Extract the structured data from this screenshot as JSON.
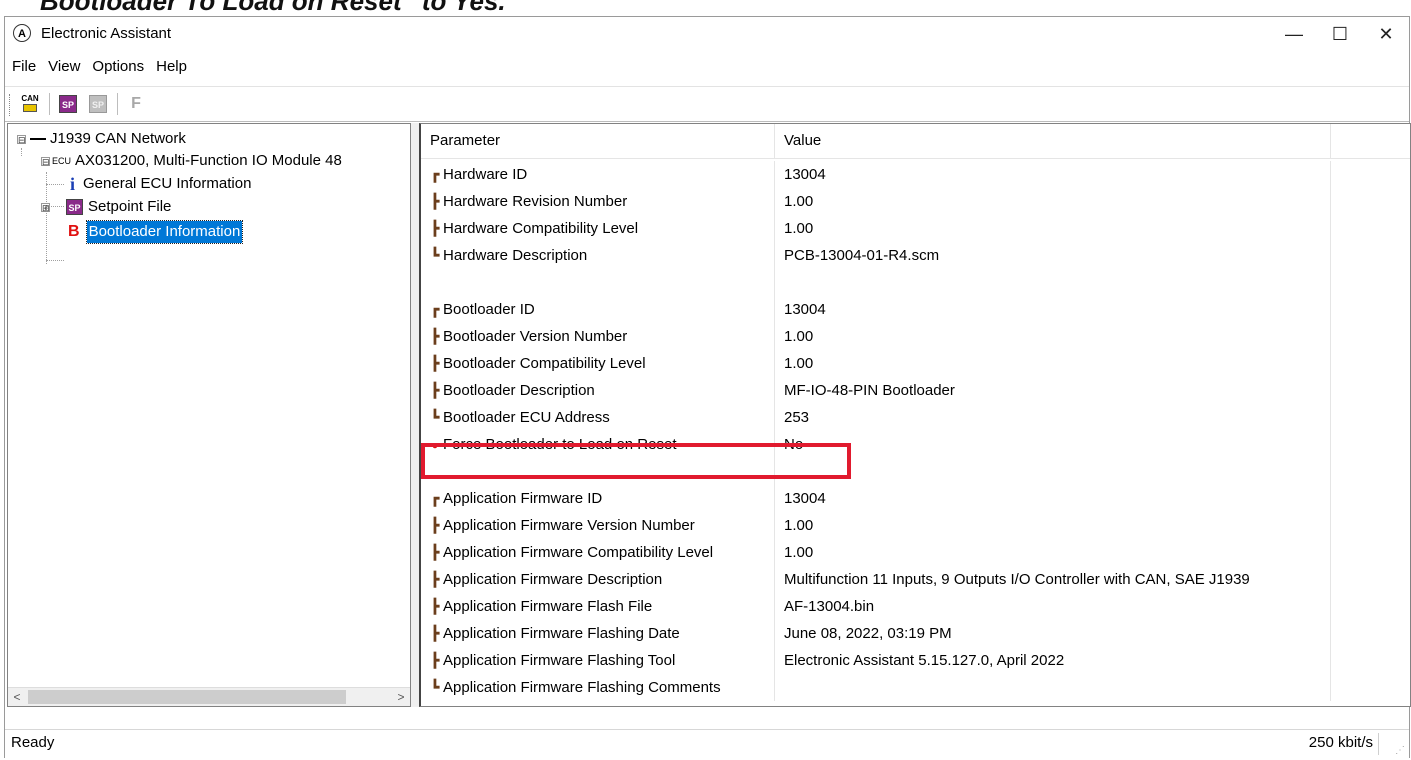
{
  "doc_heading": "Bootloader To Load on Reset” to Yes.",
  "window": {
    "title": "Electronic Assistant",
    "controls": {
      "minimize": "—",
      "maximize": "☐",
      "close": "✕"
    }
  },
  "menubar": {
    "items": [
      "File",
      "View",
      "Options",
      "Help"
    ]
  },
  "toolbar": {
    "can_icon_label": "CAN",
    "sp_icon_label": "SP",
    "sp_disabled_icon_label": "SP",
    "f_label": "F"
  },
  "tree": {
    "root": {
      "label": "J1939 CAN Network",
      "expander": "⊟"
    },
    "ecu": {
      "tag": "ECU",
      "label": "AX031200, Multi-Function IO Module 48",
      "expander": "⊟"
    },
    "items": [
      {
        "icon": "i",
        "label": "General ECU Information"
      },
      {
        "icon": "SP",
        "label": "Setpoint File",
        "expander": "⊞"
      },
      {
        "icon": "B",
        "label": "Bootloader Information"
      }
    ],
    "scroll_left": "<",
    "scroll_right": ">"
  },
  "table": {
    "headers": {
      "parameter": "Parameter",
      "value": "Value"
    },
    "rows": [
      {
        "glyph": "┏",
        "parameter": "Hardware ID",
        "value": "13004"
      },
      {
        "glyph": "┣",
        "parameter": "Hardware Revision Number",
        "value": "1.00"
      },
      {
        "glyph": "┣",
        "parameter": "Hardware Compatibility Level",
        "value": "1.00"
      },
      {
        "glyph": "┗",
        "parameter": "Hardware Description",
        "value": "PCB-13004-01-R4.scm"
      },
      {
        "glyph": "",
        "parameter": "",
        "value": ""
      },
      {
        "glyph": "┏",
        "parameter": "Bootloader ID",
        "value": "13004"
      },
      {
        "glyph": "┣",
        "parameter": "Bootloader Version Number",
        "value": "1.00"
      },
      {
        "glyph": "┣",
        "parameter": "Bootloader Compatibility Level",
        "value": "1.00"
      },
      {
        "glyph": "┣",
        "parameter": "Bootloader Description",
        "value": "MF-IO-48-PIN Bootloader"
      },
      {
        "glyph": "┗",
        "parameter": "Bootloader ECU Address",
        "value": "253"
      },
      {
        "glyph": "●",
        "parameter": "Force Bootloader to Load on Reset",
        "value": "No"
      },
      {
        "glyph": "",
        "parameter": "",
        "value": ""
      },
      {
        "glyph": "┏",
        "parameter": "Application Firmware ID",
        "value": "13004"
      },
      {
        "glyph": "┣",
        "parameter": "Application Firmware Version Number",
        "value": "1.00"
      },
      {
        "glyph": "┣",
        "parameter": "Application Firmware Compatibility Level",
        "value": "1.00"
      },
      {
        "glyph": "┣",
        "parameter": "Application Firmware Description",
        "value": "Multifunction 11 Inputs, 9 Outputs I/O Controller with CAN, SAE J1939"
      },
      {
        "glyph": "┣",
        "parameter": "Application Firmware Flash File",
        "value": "AF-13004.bin"
      },
      {
        "glyph": "┣",
        "parameter": "Application Firmware Flashing Date",
        "value": "June 08, 2022, 03:19 PM"
      },
      {
        "glyph": "┣",
        "parameter": "Application Firmware Flashing Tool",
        "value": "Electronic Assistant 5.15.127.0, April 2022"
      },
      {
        "glyph": "┗",
        "parameter": "Application Firmware Flashing Comments",
        "value": ""
      }
    ]
  },
  "statusbar": {
    "left": "Ready",
    "right": "250 kbit/s"
  },
  "colors": {
    "highlight_box": "#e11a2e",
    "selection": "#0078d7",
    "glyph": "#6b3e1c"
  }
}
